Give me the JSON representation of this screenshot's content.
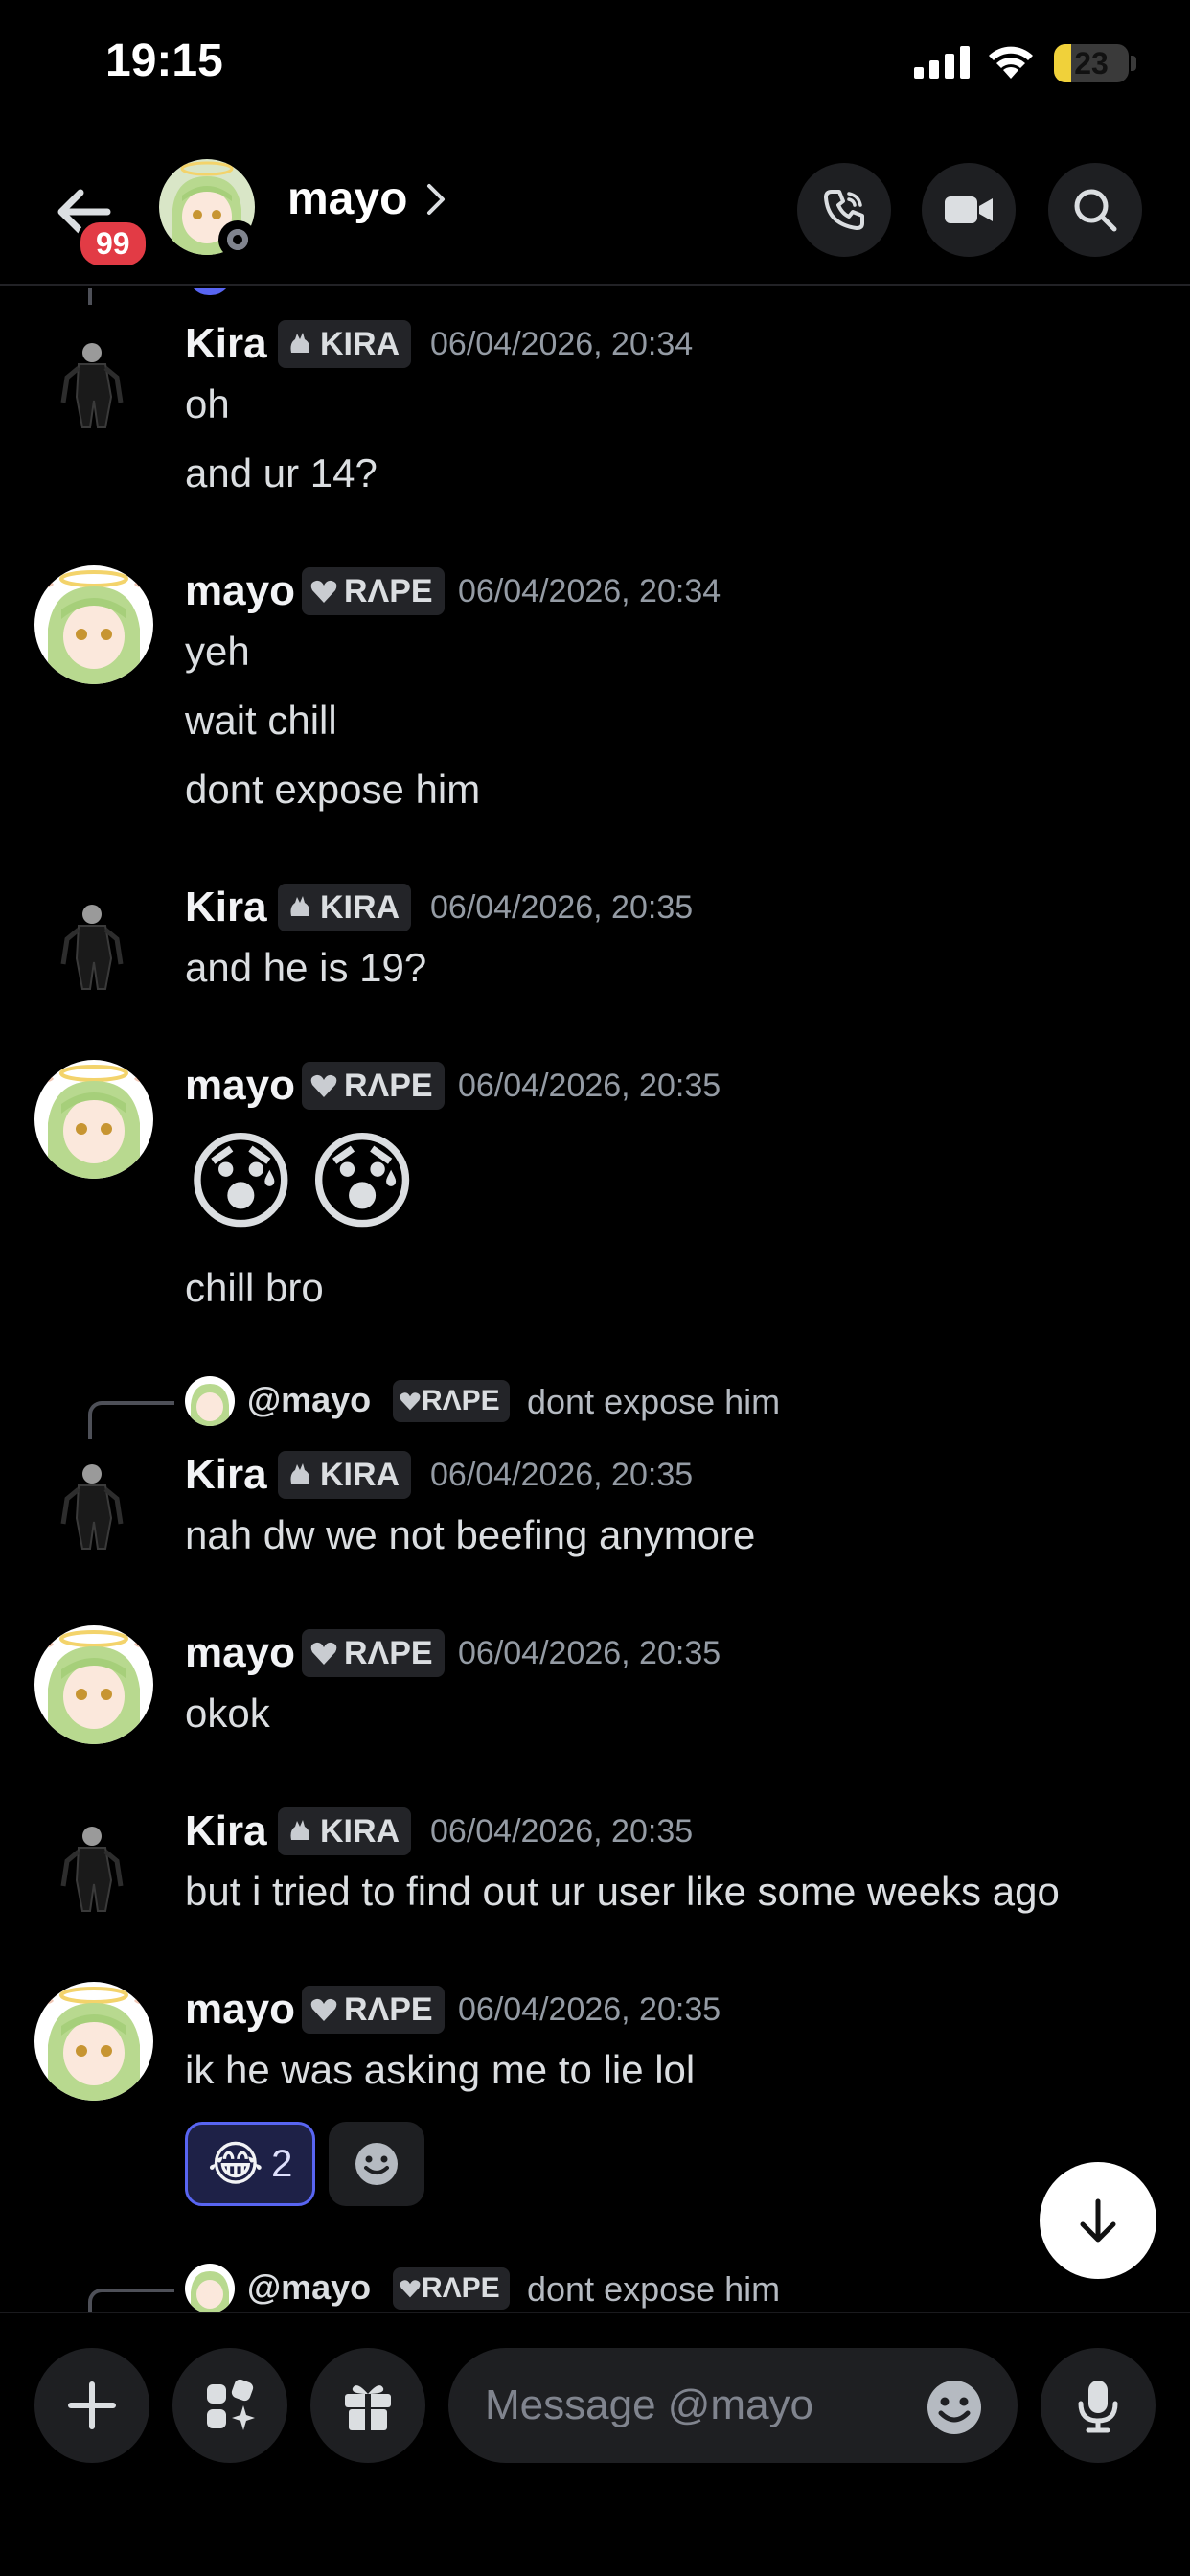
{
  "status_bar": {
    "time": "19:15",
    "battery": "23",
    "battery_level": 0.23
  },
  "header": {
    "badge": "99",
    "name": "mayo"
  },
  "messages": [
    {
      "author": "Kira",
      "tag": "KIRA",
      "time": "06/04/2026, 20:34",
      "lines": [
        "oh",
        "and ur 14?"
      ]
    },
    {
      "author": "mayo",
      "tag": "RΛPE",
      "time": "06/04/2026, 20:34",
      "lines": [
        "yeh",
        "wait chill",
        "dont expose him"
      ]
    },
    {
      "author": "Kira",
      "tag": "KIRA",
      "time": "06/04/2026, 20:35",
      "lines": [
        "and he is 19?"
      ]
    },
    {
      "author": "mayo",
      "tag": "RΛPE",
      "time": "06/04/2026, 20:35",
      "emojis": "😰😰",
      "lines": [
        "chill bro"
      ]
    },
    {
      "author": "Kira",
      "tag": "KIRA",
      "time": "06/04/2026, 20:35",
      "lines": [
        "nah dw we not beefing anymore"
      ],
      "reply": {
        "name": "@mayo",
        "tag": "RΛPE",
        "text": "dont expose him"
      }
    },
    {
      "author": "mayo",
      "tag": "RΛPE",
      "time": "06/04/2026, 20:35",
      "lines": [
        "okok"
      ]
    },
    {
      "author": "Kira",
      "tag": "KIRA",
      "time": "06/04/2026, 20:35",
      "lines": [
        "but i tried to find out ur user like some weeks ago"
      ]
    },
    {
      "author": "mayo",
      "tag": "RΛPE",
      "time": "06/04/2026, 20:35",
      "lines": [
        "ik he was asking me to lie lol"
      ],
      "reactions": [
        {
          "emoji": "😂",
          "count": "2"
        }
      ]
    }
  ],
  "bottom_reply": {
    "name": "@mayo",
    "tag": "RΛPE",
    "text": "dont expose him"
  },
  "composer": {
    "placeholder": "Message @mayo"
  },
  "colors": {
    "accent": "#5865f2",
    "badge_red": "#e23b45",
    "background": "#000000"
  }
}
